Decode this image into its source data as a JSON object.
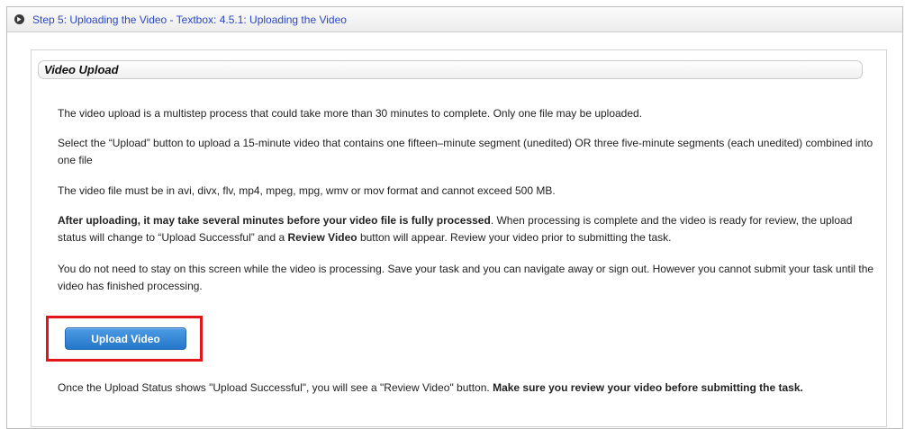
{
  "step_header": {
    "title": "Step 5: Uploading the Video - Textbox: 4.5.1: Uploading the Video",
    "icon": "collapse-circle-icon"
  },
  "section": {
    "title": "Video Upload"
  },
  "paragraphs": [
    [
      {
        "text": "The video upload is a multistep process that could take more than 30 minutes to complete. Only one file may be uploaded.",
        "bold": false
      }
    ],
    [
      {
        "text": "Select the “Upload” button to upload a 15-minute video that contains one fifteen–minute segment (unedited) OR three five-minute segments (each unedited) combined into one file",
        "bold": false
      }
    ],
    [
      {
        "text": "The video file must be in avi, divx, flv, mp4, mpeg, mpg, wmv or mov format and cannot exceed 500 MB.",
        "bold": false
      }
    ],
    [
      {
        "text": "After uploading, it may take several minutes before your video file is fully processed",
        "bold": true
      },
      {
        "text": ". When processing is complete and the video is ready for review, the upload status will change to “Upload Successful” and a ",
        "bold": false
      },
      {
        "text": "Review Video",
        "bold": true
      },
      {
        "text": " button will appear. Review your video prior to submitting the task.",
        "bold": false
      }
    ],
    [
      {
        "text": "You do not need to stay on this screen while the video is processing. Save your task and you can navigate away or sign out. However you cannot submit your task until the video has finished processing.",
        "bold": false
      }
    ]
  ],
  "upload_button": {
    "label": "Upload Video"
  },
  "footer_note": [
    {
      "text": "Once the Upload Status shows \"Upload Successful\", you will see a \"Review Video\" button. ",
      "bold": false
    },
    {
      "text": "Make sure you review your video before submitting the task.",
      "bold": true
    }
  ],
  "colors": {
    "link_blue": "#2b47c9",
    "button_blue": "#2577c9",
    "highlight_red": "#e0161b"
  }
}
